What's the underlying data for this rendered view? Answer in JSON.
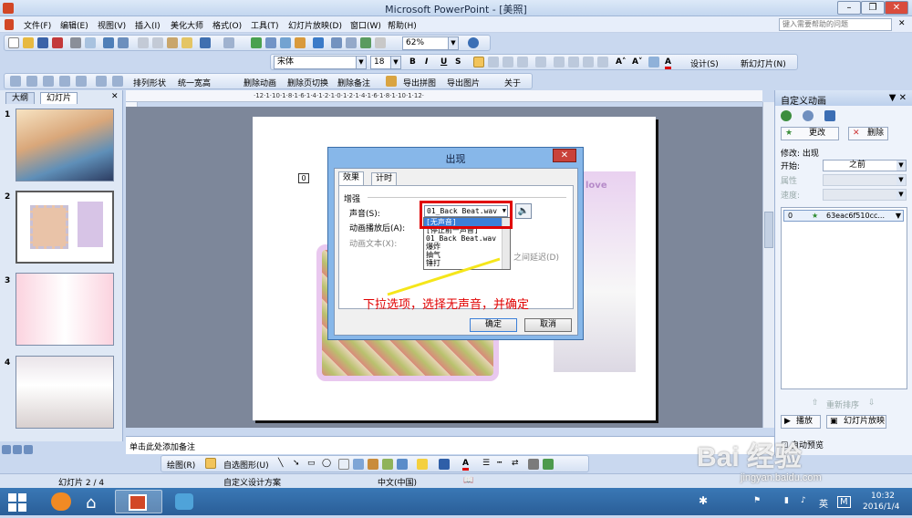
{
  "window": {
    "title": "Microsoft PowerPoint - [美照]",
    "help_placeholder": "键入需要帮助的问题"
  },
  "menu": [
    "文件(F)",
    "编辑(E)",
    "视图(V)",
    "插入(I)",
    "美化大师",
    "格式(O)",
    "工具(T)",
    "幻灯片放映(D)",
    "窗口(W)",
    "帮助(H)"
  ],
  "toolbar": {
    "zoom": "62%",
    "font": "宋体",
    "font_size": "18",
    "design": "设计(S)",
    "new_slide": "新幻灯片(N)"
  },
  "toolbar3": [
    "排列形状",
    "统一宽高",
    "删除动画",
    "删除页切换",
    "删除备注",
    "导出拼图",
    "导出图片",
    "关于"
  ],
  "left_tabs": {
    "outline": "大纲",
    "slides": "幻灯片"
  },
  "slides": [
    "1",
    "2",
    "3",
    "4"
  ],
  "slide_badge": "0",
  "notes_placeholder": "单击此处添加备注",
  "taskpane": {
    "title": "自定义动画",
    "change_button": "更改",
    "delete_button": "删除",
    "modify_label": "修改: 出现",
    "start_label": "开始:",
    "start_value": "之前",
    "property_label": "属性",
    "speed_label": "速度:",
    "list_item_num": "0",
    "list_item_name": "63eac6f510cc...",
    "reorder_label": "重新排序",
    "play_button": "播放",
    "slideshow_button": "幻灯片放映",
    "autopreview_label": "自动预览"
  },
  "dialog": {
    "title": "出现",
    "tabs": [
      "效果",
      "计时"
    ],
    "section": "增强",
    "sound_label": "声音(S):",
    "sound_value": "01_Back Beat.wav",
    "after_label": "动画播放后(A):",
    "text_label": "动画文本(X):",
    "delay_label": "之间延迟(D)",
    "sound_options": [
      "[无声音]",
      "[停止前一声音]",
      "01_Back Beat.wav",
      "爆炸",
      "抽气",
      "锤打"
    ],
    "ok": "确定",
    "cancel": "取消"
  },
  "annotation": "下拉选项，选择无声音，并确定",
  "drawbar": {
    "draw": "绘图(R)",
    "autoshape": "自选图形(U)"
  },
  "status": {
    "slide": "幻灯片 2 / 4",
    "design": "自定义设计方案",
    "lang": "中文(中国)"
  },
  "clock": {
    "time": "10:32",
    "date": "2016/1/4"
  },
  "tray": {
    "ime": "英",
    "ime2": "M"
  },
  "watermark": {
    "brand": "Bai 经验",
    "url": "jingyan.baidu.com"
  },
  "colors": {
    "accent_red": "#e00000",
    "titlebar": "#c3d6ef",
    "taskbar": "#2a5e98"
  }
}
